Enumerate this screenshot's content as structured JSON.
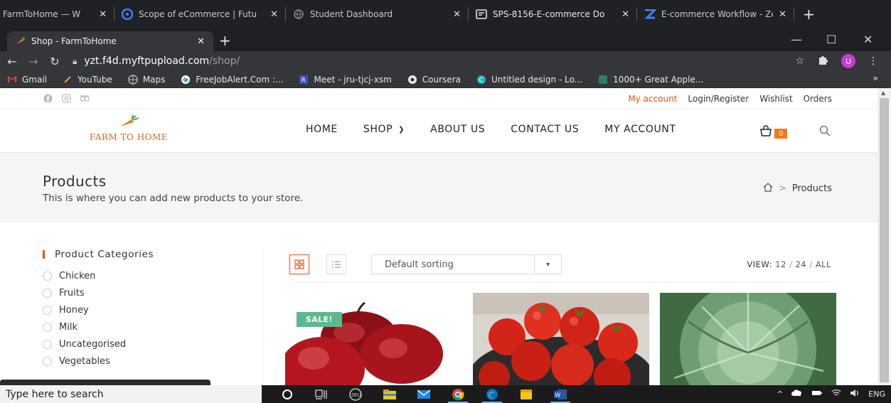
{
  "outer_tabs": [
    {
      "label": "FarmToHome — W",
      "icon": "leaf-icon"
    },
    {
      "label": "Scope of eCommerce | Futu",
      "icon": "edge-swirl-icon"
    },
    {
      "label": "Student Dashboard",
      "icon": "globe-icon"
    },
    {
      "label": "SPS-8156-E-commerce Do",
      "icon": "doc-icon"
    },
    {
      "label": "E-commerce Workflow - Ze",
      "icon": "zoho-icon"
    }
  ],
  "browser": {
    "active_tab": "Shop - FarmToHome",
    "url_host": "yzt.f4d.myftpupload.com",
    "url_path": "/shop/",
    "profile_initial": "U"
  },
  "bookmarks": [
    {
      "label": "Gmail",
      "icon": "gmail-icon"
    },
    {
      "label": "YouTube",
      "icon": "youtube-icon"
    },
    {
      "label": "Maps",
      "icon": "maps-icon"
    },
    {
      "label": "FreeJobAlert.Com :...",
      "icon": "google-icon"
    },
    {
      "label": "Meet - jru-tjcj-xsm",
      "icon": "meet-icon"
    },
    {
      "label": "Coursera",
      "icon": "coursera-icon"
    },
    {
      "label": "Untitled design - Lo...",
      "icon": "canva-icon"
    },
    {
      "label": "1000+ Great Apple...",
      "icon": "bookmark-icon"
    }
  ],
  "site": {
    "top_links": [
      "My account",
      "Login/Register",
      "Wishlist",
      "Orders"
    ],
    "logo_text": "FARM TO HOME",
    "nav": [
      "HOME",
      "SHOP",
      "ABOUT US",
      "CONTACT US",
      "MY ACCOUNT"
    ],
    "cart_count": "0",
    "page_title": "Products",
    "page_subtitle": "This is where you can add new products to your store.",
    "breadcrumb": "Products",
    "breadcrumb_sep": ">",
    "categories_title": "Product Categories",
    "categories": [
      "Chicken",
      "Fruits",
      "Honey",
      "Milk",
      "Uncategorised",
      "Vegetables"
    ],
    "sorting": "Default sorting",
    "view_label": "VIEW:",
    "view_options": [
      "12",
      "24",
      "ALL"
    ],
    "sale_badge": "SALE!",
    "products": [
      {
        "image": "red apples",
        "on_sale": true
      },
      {
        "image": "tomatoes",
        "on_sale": false
      },
      {
        "image": "cabbage",
        "on_sale": false
      }
    ]
  },
  "taskbar": {
    "search_placeholder": "Type here to search",
    "language": "ENG"
  },
  "colors": {
    "accent": "#e2561d",
    "sale": "#5fb88d",
    "cart_badge": "#f07b1d",
    "logo": "#d66a1f"
  }
}
